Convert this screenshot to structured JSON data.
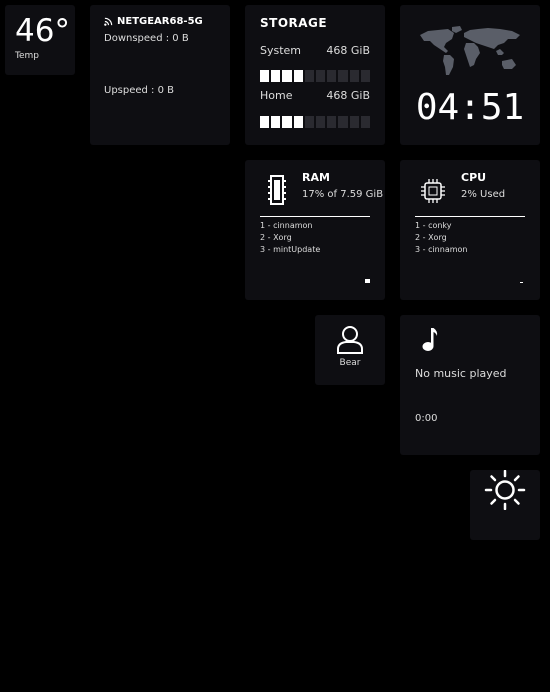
{
  "temp": {
    "value": "46°",
    "label": "Temp"
  },
  "network": {
    "ssid": "NETGEAR68-5G",
    "downspeed": "Downspeed : 0 B",
    "upspeed": "Upspeed : 0 B"
  },
  "storage": {
    "title": "STORAGE",
    "drives": [
      {
        "name": "System",
        "size": "468 GiB",
        "fill": 0.4
      },
      {
        "name": "Home",
        "size": "468 GiB",
        "fill": 0.4
      }
    ]
  },
  "clock": {
    "time": "04:51"
  },
  "ram": {
    "title": "RAM",
    "value": "17% of 7.59 GiB",
    "processes": [
      "1 - cinnamon",
      "2 - Xorg",
      "3 - mintUpdate"
    ]
  },
  "cpu": {
    "title": "CPU",
    "value": "2% Used",
    "processes": [
      "1 - conky",
      "2 - Xorg",
      "3 - cinnamon"
    ]
  },
  "user": {
    "name": "Bear"
  },
  "music": {
    "status": "No music played",
    "time": "0:00"
  },
  "icons": {
    "wifi": "wifi-icon",
    "ram": "ram-chip-icon",
    "cpu": "cpu-chip-icon",
    "user": "user-icon",
    "music": "music-note-icon",
    "weather": "sun-icon",
    "map": "world-map-icon"
  },
  "colors": {
    "background": "#000000",
    "tile": "#0e0e12",
    "text": "#ffffff",
    "bar_off": "#2a2a30"
  }
}
